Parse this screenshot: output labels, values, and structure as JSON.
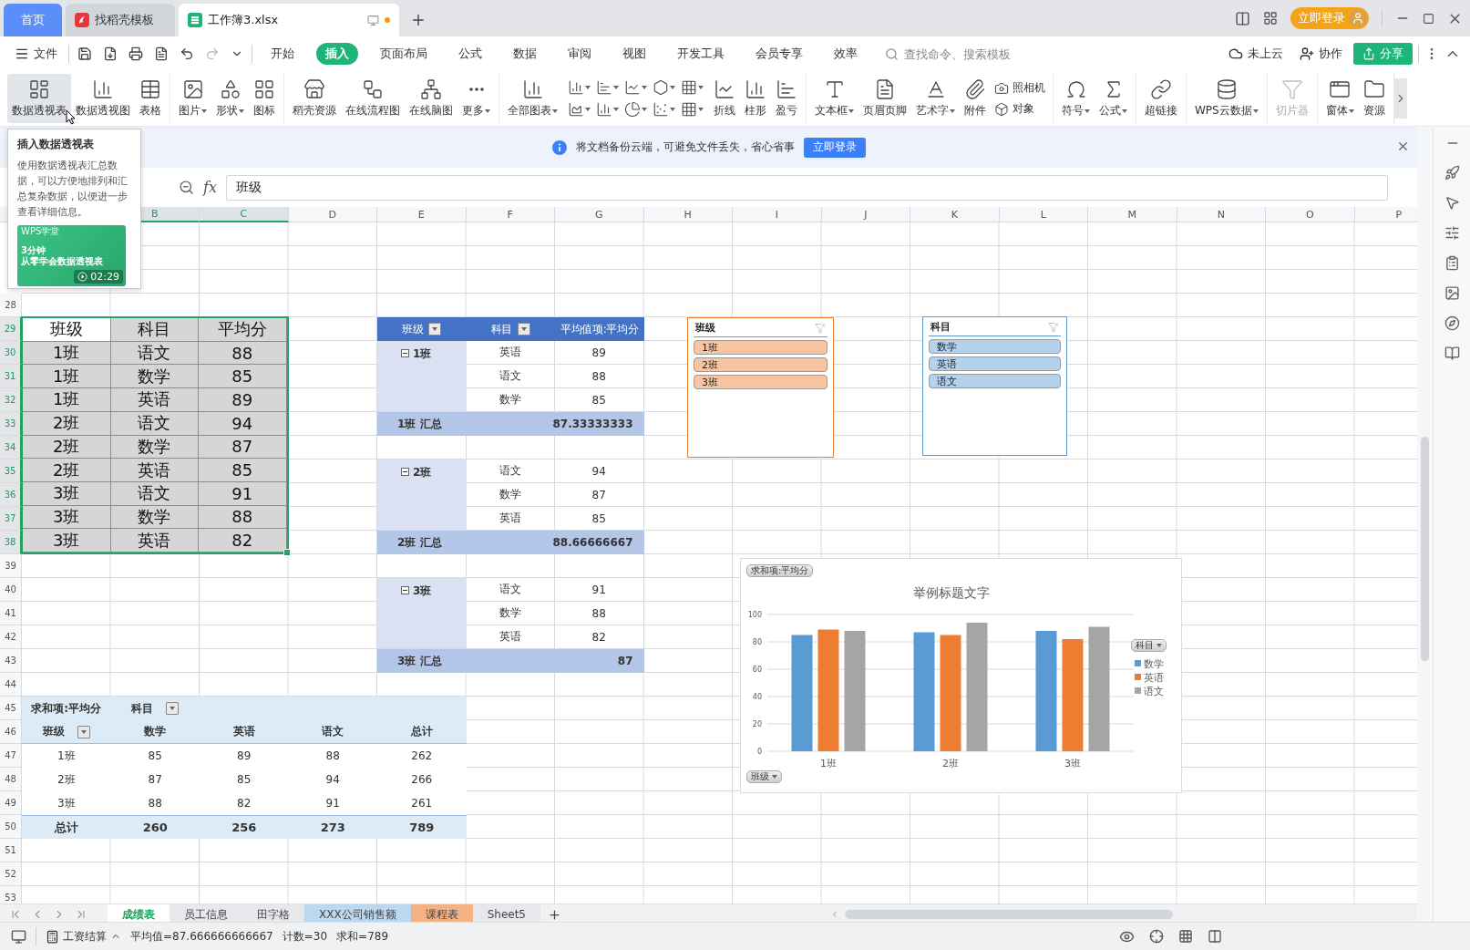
{
  "tab_bar": {
    "tabs": [
      {
        "label": "首页",
        "kind": "home",
        "selected": false,
        "unsaved": false
      },
      {
        "label": "找稻壳模板",
        "kind": "template",
        "selected": false,
        "unsaved": false
      },
      {
        "label": "工作簿3.xlsx",
        "kind": "sheet",
        "selected": true,
        "unsaved": true
      }
    ],
    "login": "立即登录"
  },
  "menu_bar": {
    "file": "文件",
    "tabs": [
      {
        "label": "开始",
        "selected": false
      },
      {
        "label": "插入",
        "selected": true
      },
      {
        "label": "页面布局",
        "selected": false
      },
      {
        "label": "公式",
        "selected": false
      },
      {
        "label": "数据",
        "selected": false
      },
      {
        "label": "审阅",
        "selected": false
      },
      {
        "label": "视图",
        "selected": false
      },
      {
        "label": "开发工具",
        "selected": false
      },
      {
        "label": "会员专享",
        "selected": false
      },
      {
        "label": "效率",
        "selected": false
      }
    ],
    "search": {
      "placeholder": "查找命令、搜索模板"
    },
    "cloud": "未上云",
    "collab": "协作",
    "share": "分享"
  },
  "ribbon": {
    "groups": [
      {
        "items": [
          {
            "kind": "large",
            "label": "数据透视表",
            "dropdown": false,
            "highlighted": true,
            "disabled": false
          },
          {
            "kind": "large",
            "label": "数据透视图",
            "dropdown": false,
            "highlighted": false,
            "disabled": false
          },
          {
            "kind": "large",
            "label": "表格",
            "dropdown": false,
            "highlighted": false,
            "disabled": false
          }
        ]
      },
      {
        "items": [
          {
            "kind": "large",
            "label": "图片",
            "dropdown": true,
            "highlighted": false,
            "disabled": false
          },
          {
            "kind": "large",
            "label": "形状",
            "dropdown": true,
            "highlighted": false,
            "disabled": false
          },
          {
            "kind": "large",
            "label": "图标",
            "dropdown": false,
            "highlighted": false,
            "disabled": false
          }
        ]
      },
      {
        "items": [
          {
            "kind": "large",
            "label": "稻壳资源",
            "dropdown": false,
            "highlighted": false,
            "disabled": false
          },
          {
            "kind": "large",
            "label": "在线流程图",
            "dropdown": false,
            "highlighted": false,
            "disabled": false
          },
          {
            "kind": "large",
            "label": "在线脑图",
            "dropdown": false,
            "highlighted": false,
            "disabled": false
          },
          {
            "kind": "large",
            "label": "更多",
            "dropdown": true,
            "highlighted": false,
            "disabled": false
          }
        ]
      },
      {
        "items": [
          {
            "kind": "large",
            "label": "全部图表",
            "dropdown": true,
            "highlighted": false,
            "disabled": false
          },
          {
            "kind": "chart_icons"
          },
          {
            "kind": "large",
            "label": "折线",
            "dropdown": false,
            "highlighted": false,
            "disabled": false
          },
          {
            "kind": "large",
            "label": "柱形",
            "dropdown": false,
            "highlighted": false,
            "disabled": false
          },
          {
            "kind": "large",
            "label": "盈亏",
            "dropdown": false,
            "highlighted": false,
            "disabled": false
          }
        ]
      },
      {
        "items": [
          {
            "kind": "large",
            "label": "文本框",
            "dropdown": true,
            "highlighted": false,
            "disabled": false
          },
          {
            "kind": "large",
            "label": "页眉页脚",
            "dropdown": false,
            "highlighted": false,
            "disabled": false
          },
          {
            "kind": "large",
            "label": "艺术字",
            "dropdown": true,
            "highlighted": false,
            "disabled": false
          },
          {
            "kind": "large",
            "label": "附件",
            "dropdown": false,
            "highlighted": false,
            "disabled": false
          },
          {
            "kind": "stack",
            "items": [
              {
                "label": "照相机"
              },
              {
                "label": "对象"
              }
            ]
          }
        ]
      },
      {
        "items": [
          {
            "kind": "large",
            "label": "符号",
            "dropdown": true,
            "highlighted": false,
            "disabled": false
          },
          {
            "kind": "large",
            "label": "公式",
            "dropdown": true,
            "highlighted": false,
            "disabled": false
          }
        ]
      },
      {
        "items": [
          {
            "kind": "large",
            "label": "超链接",
            "dropdown": false,
            "highlighted": false,
            "disabled": false
          }
        ]
      },
      {
        "items": [
          {
            "kind": "large",
            "label": "WPS云数据",
            "dropdown": true,
            "highlighted": false,
            "disabled": false
          }
        ]
      },
      {
        "items": [
          {
            "kind": "large",
            "label": "切片器",
            "dropdown": false,
            "highlighted": false,
            "disabled": true
          }
        ]
      },
      {
        "items": [
          {
            "kind": "large",
            "label": "窗体",
            "dropdown": true,
            "highlighted": false,
            "disabled": false
          },
          {
            "kind": "large",
            "label": "资源",
            "dropdown": false,
            "highlighted": false,
            "disabled": false
          }
        ]
      }
    ]
  },
  "tooltip": {
    "title": "插入数据透视表",
    "text": "使用数据透视表汇总数据，可以方便地排列和汇总复杂数据，以便进一步查看详细信息。",
    "video": {
      "brand": "WPS学堂",
      "line_1": "3分钟",
      "line_2": "从零学会数据透视表",
      "duration": "02:29"
    }
  },
  "notification": {
    "text": "将文档备份云端，可避免文件丢失，省心省事",
    "button": "立即登录"
  },
  "formula_bar": {
    "function_label": "fx",
    "value": "班级"
  },
  "sheet": {
    "column_headers": [
      {
        "label": "B",
        "selected": true
      },
      {
        "label": "C",
        "selected": true
      },
      {
        "label": "D",
        "selected": false
      },
      {
        "label": "E",
        "selected": false
      },
      {
        "label": "F",
        "selected": false
      },
      {
        "label": "G",
        "selected": false
      },
      {
        "label": "H",
        "selected": false
      },
      {
        "label": "I",
        "selected": false
      },
      {
        "label": "J",
        "selected": false
      },
      {
        "label": "K",
        "selected": false
      },
      {
        "label": "L",
        "selected": false
      },
      {
        "label": "M",
        "selected": false
      },
      {
        "label": "N",
        "selected": false
      },
      {
        "label": "O",
        "selected": false
      },
      {
        "label": "P",
        "selected": false
      }
    ],
    "row_numbers": [
      {
        "label": "28",
        "selected": false
      },
      {
        "label": "29",
        "selected": true
      },
      {
        "label": "30",
        "selected": true
      },
      {
        "label": "31",
        "selected": true
      },
      {
        "label": "32",
        "selected": true
      },
      {
        "label": "33",
        "selected": true
      },
      {
        "label": "34",
        "selected": true
      },
      {
        "label": "35",
        "selected": true
      },
      {
        "label": "36",
        "selected": true
      },
      {
        "label": "37",
        "selected": true
      },
      {
        "label": "38",
        "selected": true
      },
      {
        "label": "39",
        "selected": false
      },
      {
        "label": "40",
        "selected": false
      },
      {
        "label": "41",
        "selected": false
      },
      {
        "label": "42",
        "selected": false
      },
      {
        "label": "43",
        "selected": false
      },
      {
        "label": "44",
        "selected": false
      },
      {
        "label": "45",
        "selected": false
      },
      {
        "label": "46",
        "selected": false
      },
      {
        "label": "47",
        "selected": false
      },
      {
        "label": "48",
        "selected": false
      },
      {
        "label": "49",
        "selected": false
      },
      {
        "label": "50",
        "selected": false
      },
      {
        "label": "51",
        "selected": false
      },
      {
        "label": "52",
        "selected": false
      },
      {
        "label": "53",
        "selected": false
      }
    ],
    "source_table": {
      "header": [
        {
          "label": "班级",
          "active": true
        },
        {
          "label": "科目",
          "active": false
        },
        {
          "label": "平均分",
          "active": false
        }
      ],
      "rows": [
        [
          "1班",
          "语文",
          "88"
        ],
        [
          "1班",
          "数学",
          "85"
        ],
        [
          "1班",
          "英语",
          "89"
        ],
        [
          "2班",
          "语文",
          "94"
        ],
        [
          "2班",
          "数学",
          "87"
        ],
        [
          "2班",
          "英语",
          "85"
        ],
        [
          "3班",
          "语文",
          "91"
        ],
        [
          "3班",
          "数学",
          "88"
        ],
        [
          "3班",
          "英语",
          "82"
        ]
      ]
    },
    "pivot_by_class": {
      "headers": [
        {
          "label": "班级",
          "filter": true
        },
        {
          "label": "科目",
          "filter": true
        },
        {
          "label": "平均值项:平均分",
          "filter": false
        }
      ],
      "groups": [
        {
          "label": "1班",
          "expanded": true,
          "rows": [
            [
              "英语",
              "89"
            ],
            [
              "语文",
              "88"
            ],
            [
              "数学",
              "85"
            ]
          ],
          "total_label": "1班 汇总",
          "total": "87.33333333"
        },
        {
          "label": "2班",
          "expanded": true,
          "rows": [
            [
              "语文",
              "94"
            ],
            [
              "数学",
              "87"
            ],
            [
              "英语",
              "85"
            ]
          ],
          "total_label": "2班 汇总",
          "total": "88.66666667"
        },
        {
          "label": "3班",
          "expanded": true,
          "rows": [
            [
              "语文",
              "91"
            ],
            [
              "数学",
              "88"
            ],
            [
              "英语",
              "82"
            ]
          ],
          "total_label": "3班 汇总",
          "total": "87"
        }
      ]
    },
    "pivot_cross": {
      "value_field": "求和项:平均分",
      "column_field": {
        "label": "科目",
        "filter": true
      },
      "row_field": {
        "label": "班级",
        "filter": true
      },
      "columns": [
        "数学",
        "英语",
        "语文",
        "总计"
      ],
      "rows": [
        {
          "label": "1班",
          "values": [
            "85",
            "89",
            "88",
            "262"
          ]
        },
        {
          "label": "2班",
          "values": [
            "87",
            "85",
            "94",
            "266"
          ]
        },
        {
          "label": "3班",
          "values": [
            "88",
            "82",
            "91",
            "261"
          ]
        }
      ],
      "total": {
        "label": "总计",
        "values": [
          "260",
          "256",
          "273",
          "789"
        ]
      }
    },
    "slicers": [
      {
        "title": "班级",
        "color": "#ed7d31",
        "items": [
          {
            "label": "1班",
            "selected": true
          },
          {
            "label": "2班",
            "selected": true
          },
          {
            "label": "3班",
            "selected": true
          }
        ]
      },
      {
        "title": "科目",
        "color": "#5b9bd5",
        "items": [
          {
            "label": "数学",
            "selected": true
          },
          {
            "label": "英语",
            "selected": true
          },
          {
            "label": "语文",
            "selected": true
          }
        ]
      }
    ],
    "chart": {
      "value_button": "求和项:平均分",
      "legend_button": "科目",
      "axis_button": "班级",
      "chart_data": {
        "type": "bar",
        "title": "举例标题文字",
        "categories": [
          "1班",
          "2班",
          "3班"
        ],
        "series": [
          {
            "name": "数学",
            "color": "#5b9bd5",
            "values": [
              85,
              87,
              88
            ]
          },
          {
            "name": "英语",
            "color": "#ed7d31",
            "values": [
              89,
              85,
              82
            ]
          },
          {
            "name": "语文",
            "color": "#a5a5a5",
            "values": [
              88,
              94,
              91
            ]
          }
        ],
        "ylim": [
          0,
          100
        ],
        "yticks": [
          0,
          20,
          40,
          60,
          80,
          100
        ],
        "grid": true,
        "legend": true
      }
    }
  },
  "sheet_tabs": [
    {
      "label": "成绩表",
      "selected": true
    },
    {
      "label": "员工信息",
      "selected": false
    },
    {
      "label": "田字格",
      "selected": false
    },
    {
      "label": "XXX公司销售额",
      "selected": false,
      "color": "#bdd7ee"
    },
    {
      "label": "课程表",
      "selected": false,
      "color": "#f4b183"
    },
    {
      "label": "Sheet5",
      "selected": false
    }
  ],
  "status_bar": {
    "macro": "工资结算",
    "stats": [
      "平均值=87.666666666667",
      "计数=30",
      "求和=789"
    ]
  }
}
